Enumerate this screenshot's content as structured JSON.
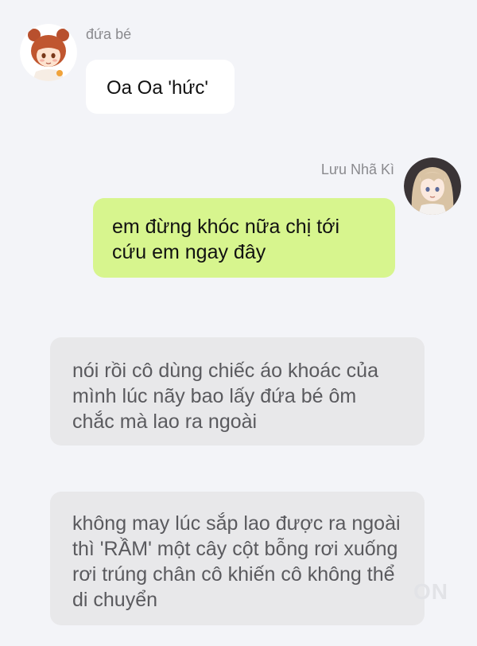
{
  "messages": [
    {
      "sender": "đứa bé",
      "text": "Oa Oa 'hức'"
    },
    {
      "sender": "Lưu Nhã Kì",
      "text": "em đừng khóc nữa chị tới cứu em ngay đây"
    }
  ],
  "narration": [
    "nói rồi cô dùng chiếc áo khoác của mình lúc nãy bao lấy đứa bé ôm chắc mà lao ra ngoài",
    "không may lúc sắp lao được ra ngoài thì 'RẦM' một cây cột bỗng rơi xuống rơi trúng chân cô khiến cô không thể di chuyển"
  ],
  "colors": {
    "background": "#f3f4f8",
    "incoming_bubble": "#ffffff",
    "outgoing_bubble": "#d7f58e",
    "narration_bubble": "#e8e8ea"
  },
  "icons": [
    "baby-avatar",
    "girl-avatar"
  ]
}
